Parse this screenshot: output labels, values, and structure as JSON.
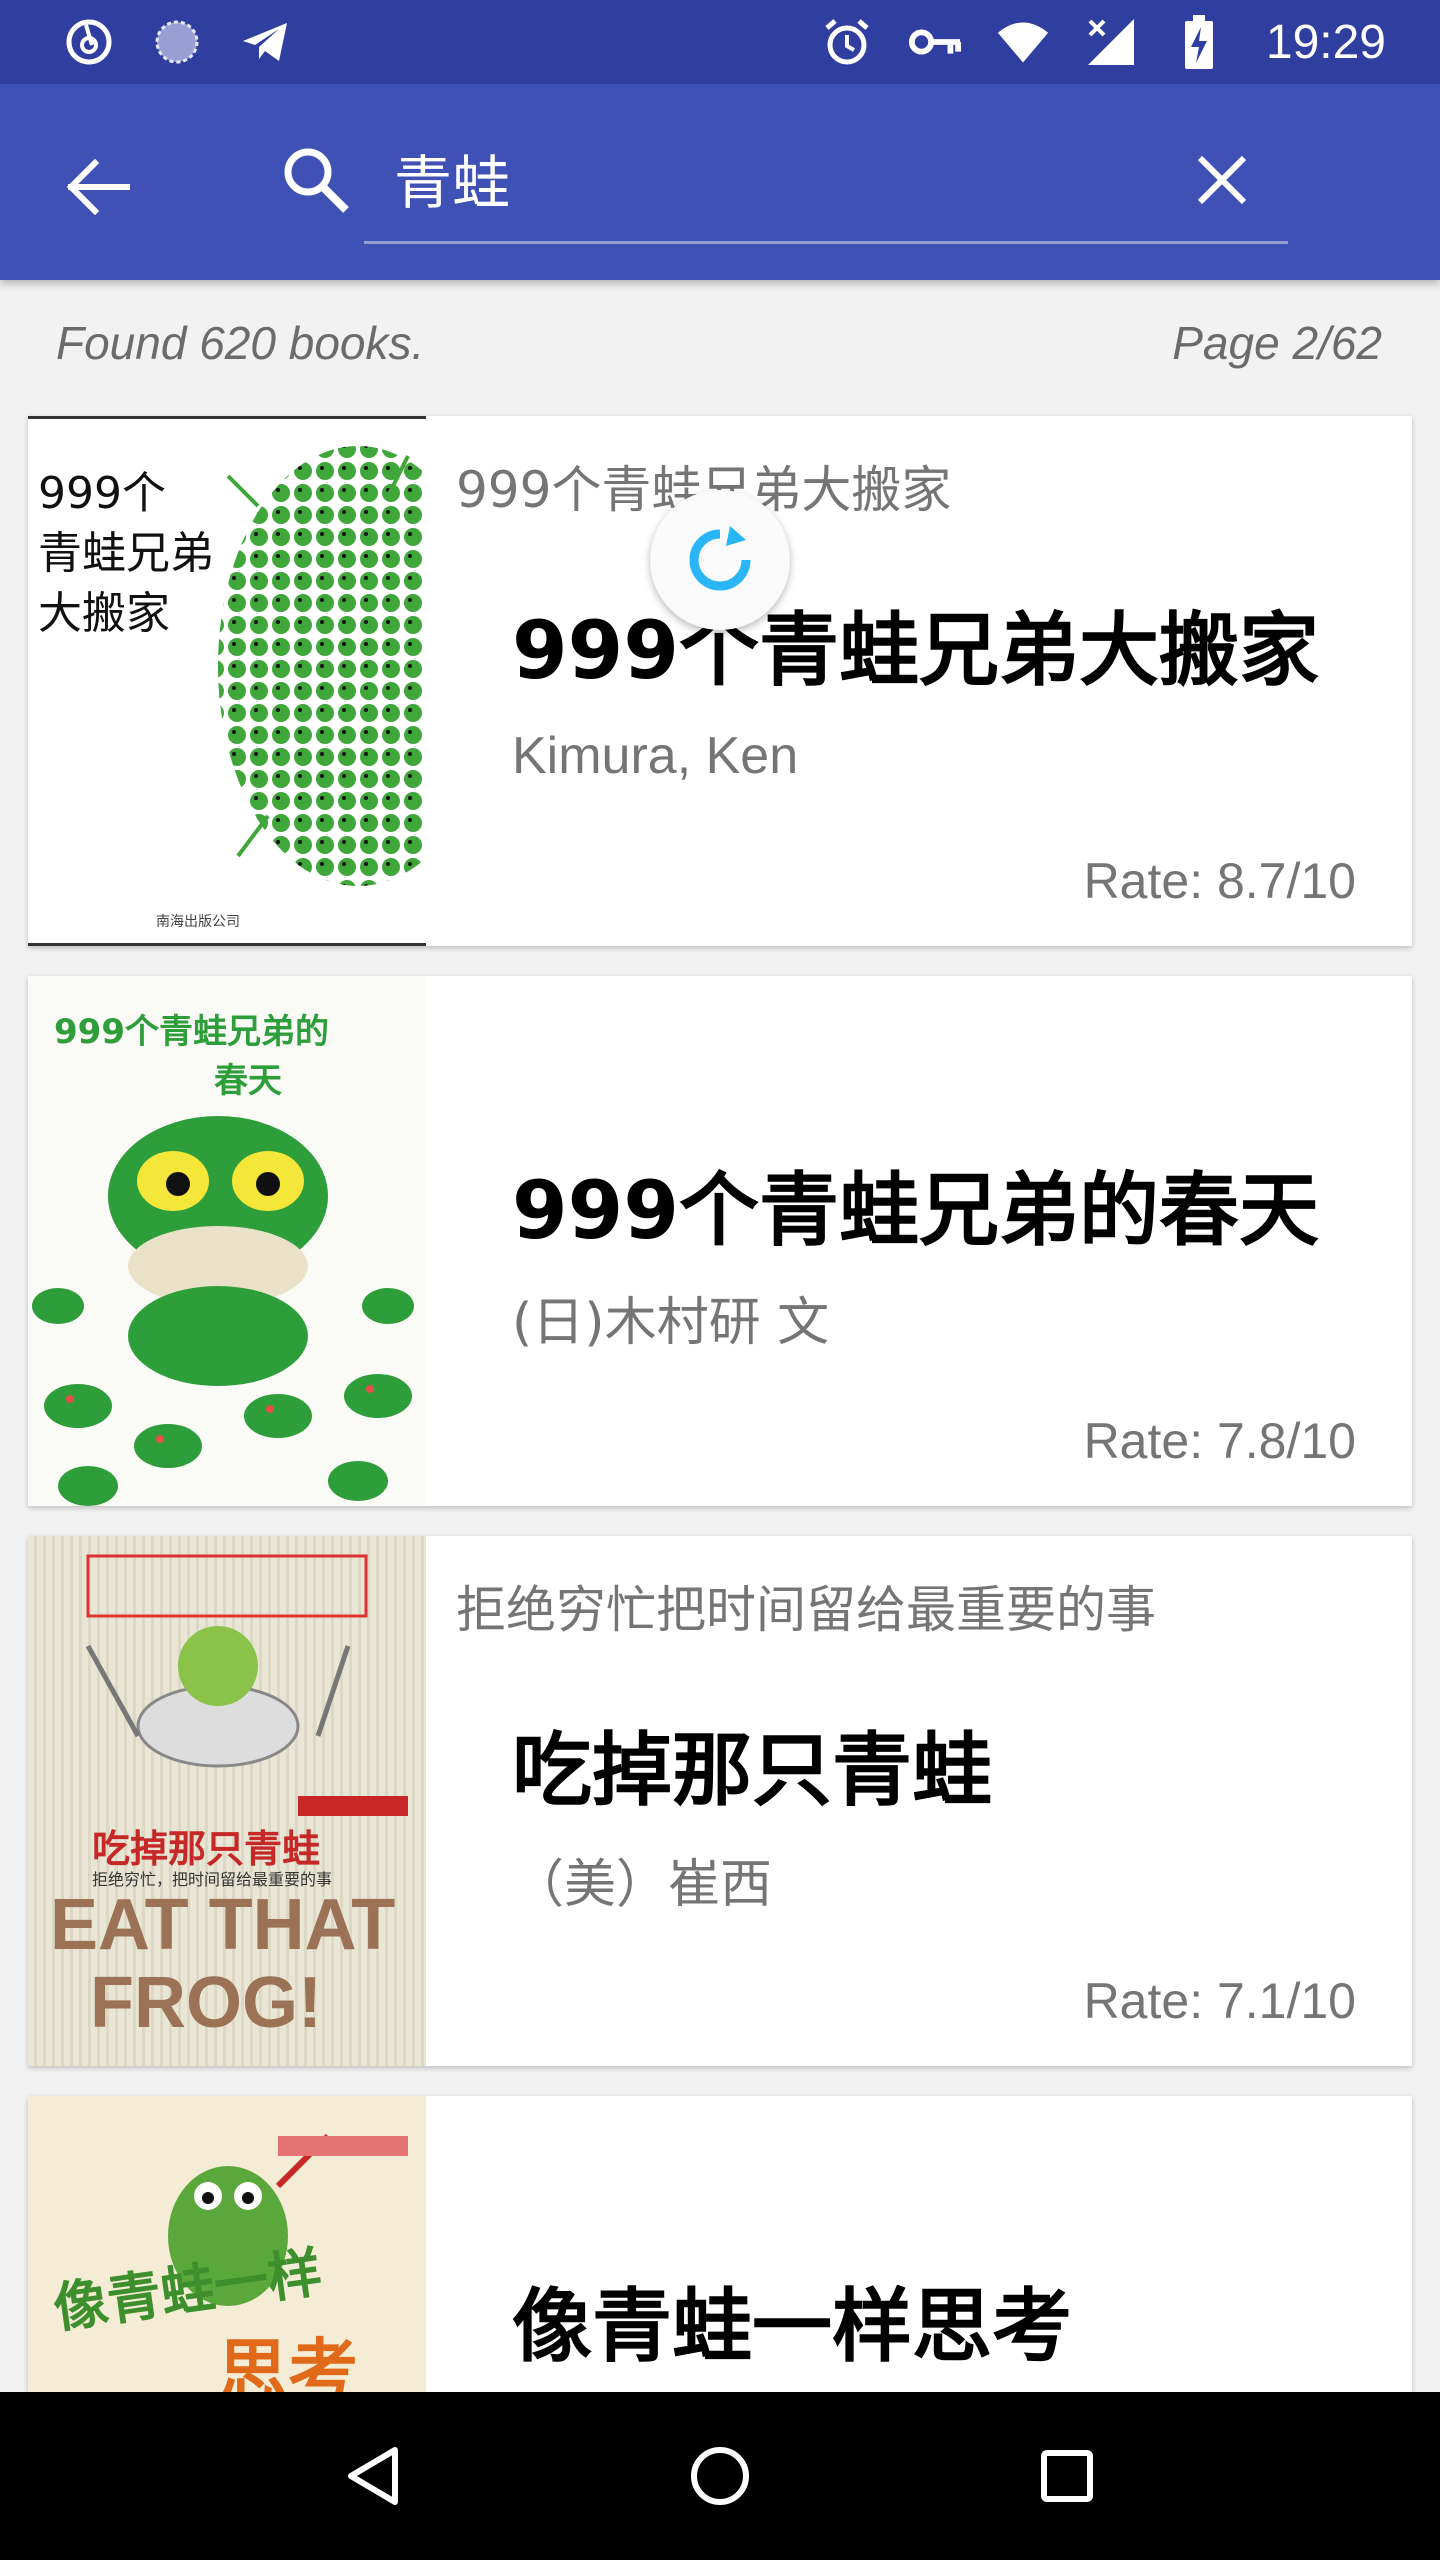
{
  "status_bar": {
    "time": "19:29",
    "left_icons": [
      "netease-music-icon",
      "sync-status-icon",
      "telegram-icon"
    ],
    "right_icons": [
      "alarm-icon",
      "vpn-key-icon",
      "wifi-icon",
      "no-signal-icon",
      "battery-charging-icon"
    ]
  },
  "search": {
    "query": "青蛙",
    "placeholder": ""
  },
  "results": {
    "found_text": "Found 620 books.",
    "page_text": "Page 2/62"
  },
  "books": [
    {
      "subtitle": "999个青蛙兄弟大搬家",
      "title": "999个青蛙兄弟大搬家",
      "author": "Kimura, Ken",
      "rate": "Rate: 8.7/10",
      "cover_text": [
        "999个",
        "青蛙兄弟",
        "大搬家"
      ]
    },
    {
      "subtitle": "",
      "title": "999个青蛙兄弟的春天",
      "author": "(日)木村研 文",
      "rate": "Rate: 7.8/10",
      "cover_text": [
        "999个青蛙兄弟的",
        "春天"
      ]
    },
    {
      "subtitle": "拒绝穷忙把时间留给最重要的事",
      "title": "吃掉那只青蛙",
      "author": "（美）崔西",
      "rate": "Rate: 7.1/10",
      "cover_text": [
        "吃掉那只青蛙",
        "拒绝穷忙，把时间留给最重要的事",
        "EAT THAT",
        "FROG!"
      ]
    },
    {
      "subtitle": "",
      "title": "像青蛙一样思考",
      "author": "",
      "rate": "",
      "cover_text": [
        "像青蛙一样",
        "思考"
      ]
    }
  ],
  "colors": {
    "status_bar": "#303f9f",
    "app_bar": "#3f51b5",
    "background": "#f2f2f2",
    "spinner": "#29b6f6",
    "frog_green": "#2e9e3a"
  },
  "nav_bar": {
    "icons": [
      "back-triangle-icon",
      "home-circle-icon",
      "recents-square-icon"
    ]
  }
}
